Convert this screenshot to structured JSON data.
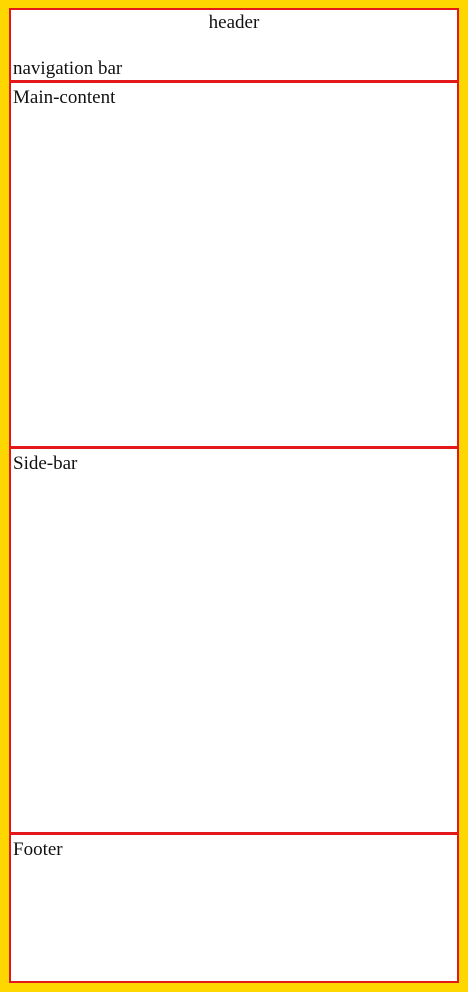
{
  "header": {
    "title": "header",
    "navigation": "navigation bar"
  },
  "main": {
    "label": "Main-content"
  },
  "sidebar": {
    "label": "Side-bar"
  },
  "footer": {
    "label": "Footer"
  },
  "colors": {
    "page_background": "#ffd700",
    "border": "#e31818",
    "panel_background": "#ffffff"
  }
}
